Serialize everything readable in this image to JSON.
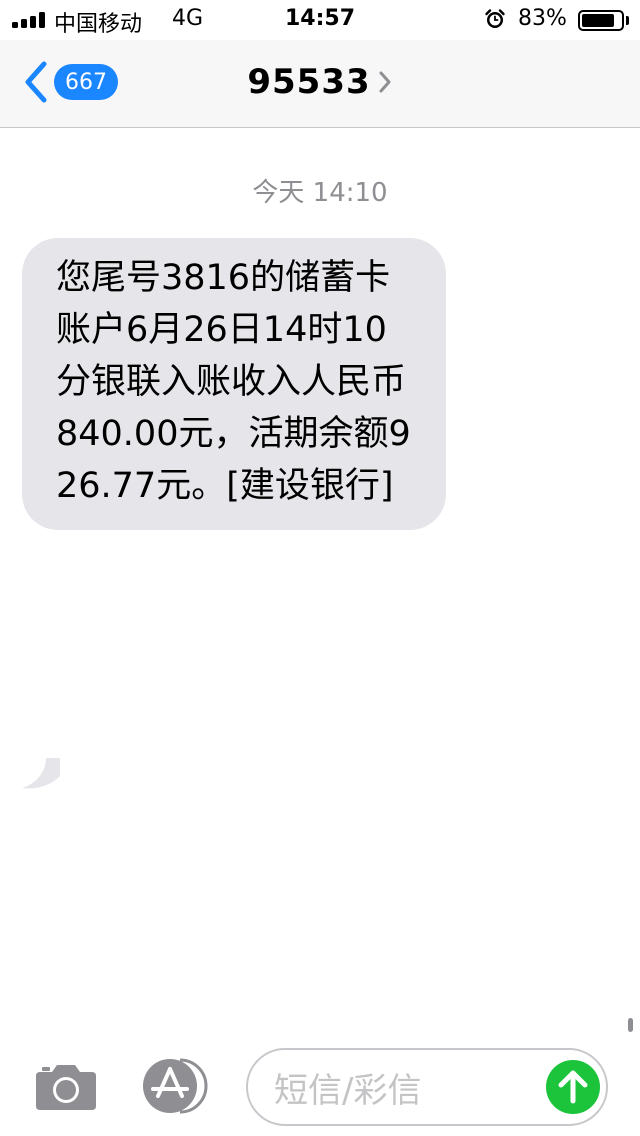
{
  "status_bar": {
    "carrier": "中国移动",
    "network": "4G",
    "time": "14:57",
    "battery_percent": "83%",
    "battery_level": 0.83
  },
  "nav": {
    "back_badge": "667",
    "contact": "95533"
  },
  "conversation": {
    "timestamp": "今天 14:10",
    "messages": [
      {
        "direction": "incoming",
        "text": "您尾号3816的储蓄卡账户6月26日14时10分银联入账收入人民币840.00元，活期余额926.77元。[建设银行]"
      }
    ]
  },
  "input": {
    "placeholder": "短信/彩信"
  },
  "colors": {
    "accent": "#1a86ff",
    "bubble": "#e5e5ea",
    "send": "#1bc43b",
    "muted": "#8e8e93"
  },
  "icons": {
    "back": "chevron-left-icon",
    "contact_detail": "chevron-right-icon",
    "camera": "camera-icon",
    "apps": "app-store-icon",
    "send": "arrow-up-icon",
    "alarm": "alarm-clock-icon"
  }
}
